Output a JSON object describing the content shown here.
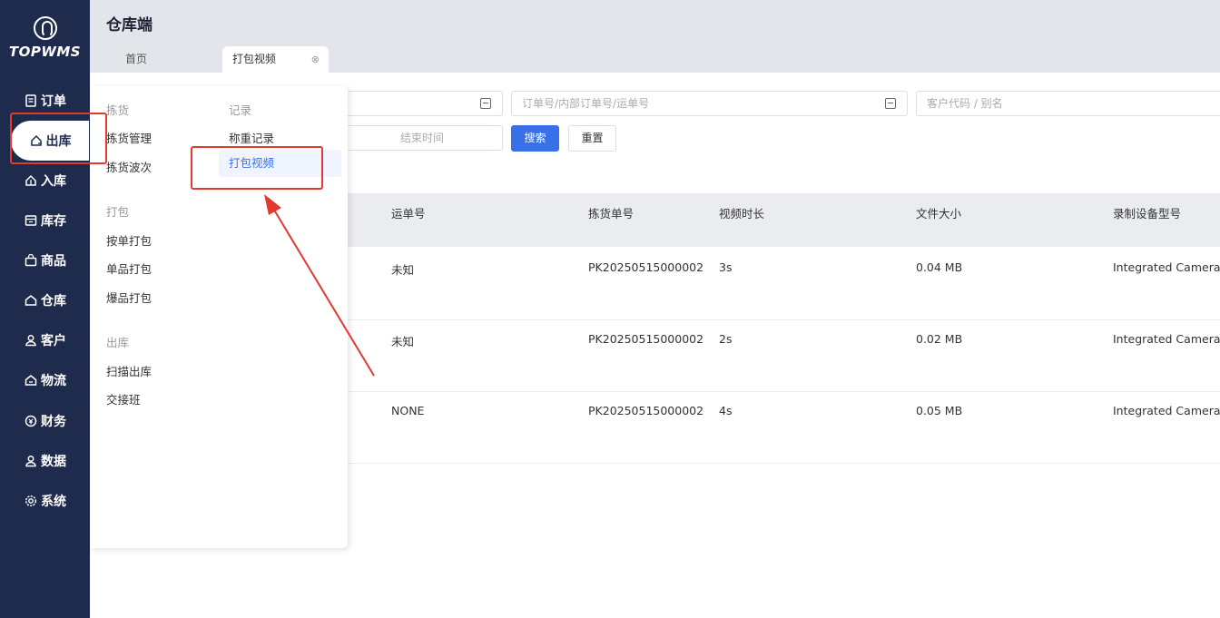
{
  "sidebar": {
    "logo": "TOPWMS",
    "items": [
      {
        "label": "订单",
        "icon": "order-icon"
      },
      {
        "label": "出库",
        "icon": "outbound-icon"
      },
      {
        "label": "入库",
        "icon": "inbound-icon"
      },
      {
        "label": "库存",
        "icon": "inventory-icon"
      },
      {
        "label": "商品",
        "icon": "product-icon"
      },
      {
        "label": "仓库",
        "icon": "warehouse-icon"
      },
      {
        "label": "客户",
        "icon": "customer-icon"
      },
      {
        "label": "物流",
        "icon": "logistics-icon"
      },
      {
        "label": "财务",
        "icon": "finance-icon"
      },
      {
        "label": "数据",
        "icon": "data-icon"
      },
      {
        "label": "系统",
        "icon": "system-icon"
      }
    ],
    "active": "出库"
  },
  "header": {
    "title": "仓库端",
    "tabs": [
      {
        "label": "首页"
      },
      {
        "label": "打包视频",
        "closable": true
      }
    ]
  },
  "filters": {
    "order_placeholder": "订单号/内部订单号/运单号",
    "customer_placeholder": "客户代码 / 别名",
    "end_time_placeholder": "结束时间",
    "search_label": "搜索",
    "reset_label": "重置"
  },
  "table": {
    "headers": [
      "运单号",
      "拣货单号",
      "视频时长",
      "文件大小",
      "录制设备型号"
    ],
    "rows": [
      {
        "waybill": "未知",
        "pick_no": "PK20250515000002",
        "duration": "3s",
        "size": "0.04 MB",
        "device": "Integrated Camera ("
      },
      {
        "waybill": "未知",
        "pick_no": "PK20250515000002",
        "duration": "2s",
        "size": "0.02 MB",
        "device": "Integrated Camera ("
      },
      {
        "waybill": "NONE",
        "pick_no": "PK20250515000002",
        "duration": "4s",
        "size": "0.05 MB",
        "device": "Integrated Camera ("
      }
    ]
  },
  "dropdown": {
    "groups": [
      {
        "title": "拣货",
        "items": [
          "拣货管理",
          "拣货波次"
        ]
      },
      {
        "title": "打包",
        "items": [
          "按单打包",
          "单品打包",
          "爆品打包"
        ]
      },
      {
        "title": "出库",
        "items": [
          "扫描出库",
          "交接班"
        ]
      },
      {
        "title": "记录",
        "items": [
          "称重记录",
          "打包视频"
        ]
      }
    ],
    "active_item": "打包视频"
  },
  "colors": {
    "sidebar_bg": "#1f2b4d",
    "primary": "#3870e8",
    "highlight": "#e23a2d"
  }
}
